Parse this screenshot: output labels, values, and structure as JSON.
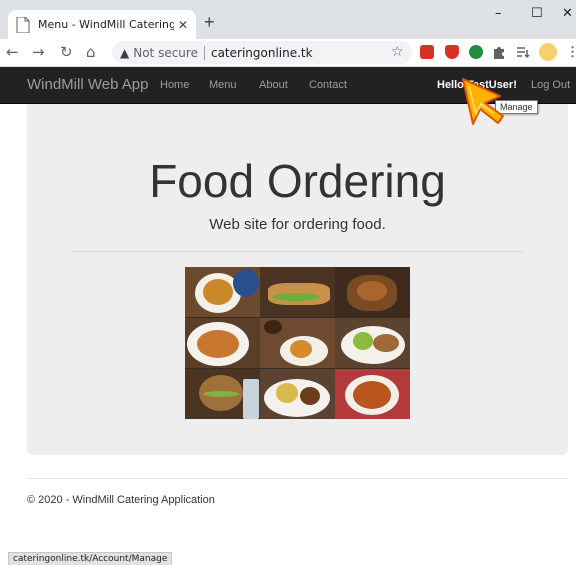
{
  "browser": {
    "tab_title": "Menu - WindMill Catering WebA",
    "tab_close": "✕",
    "new_tab": "+",
    "minimize": "–",
    "maximize": "☐",
    "close": "✕",
    "back": "←",
    "forward": "→",
    "reload": "↻",
    "home": "⌂",
    "not_secure": "Not secure",
    "url": "cateringonline.tk",
    "star": "☆",
    "status_url": "cateringonline.tk/Account/Manage"
  },
  "navbar": {
    "brand": "WindMill Web App",
    "links": [
      "Home",
      "Menu",
      "About",
      "Contact"
    ],
    "greeting": "Hello TestUser!",
    "logout": "Log Out",
    "tooltip": "Manage"
  },
  "jumbotron": {
    "title": "Food Ordering",
    "lead": "Web site for ordering food."
  },
  "footer": {
    "copyright": "© 2020 - WindMill Catering Application"
  },
  "colors": {
    "navbar_bg": "#222222",
    "jumbotron_bg": "#eeeeee",
    "ext_red": "#d93025",
    "ext_green": "#1e8e3e"
  },
  "icons": [
    "document-icon",
    "warning-icon",
    "star-icon",
    "extension-icon",
    "puzzle-icon",
    "reading-list-icon",
    "avatar-icon",
    "menu-icon",
    "cursor-icon"
  ]
}
